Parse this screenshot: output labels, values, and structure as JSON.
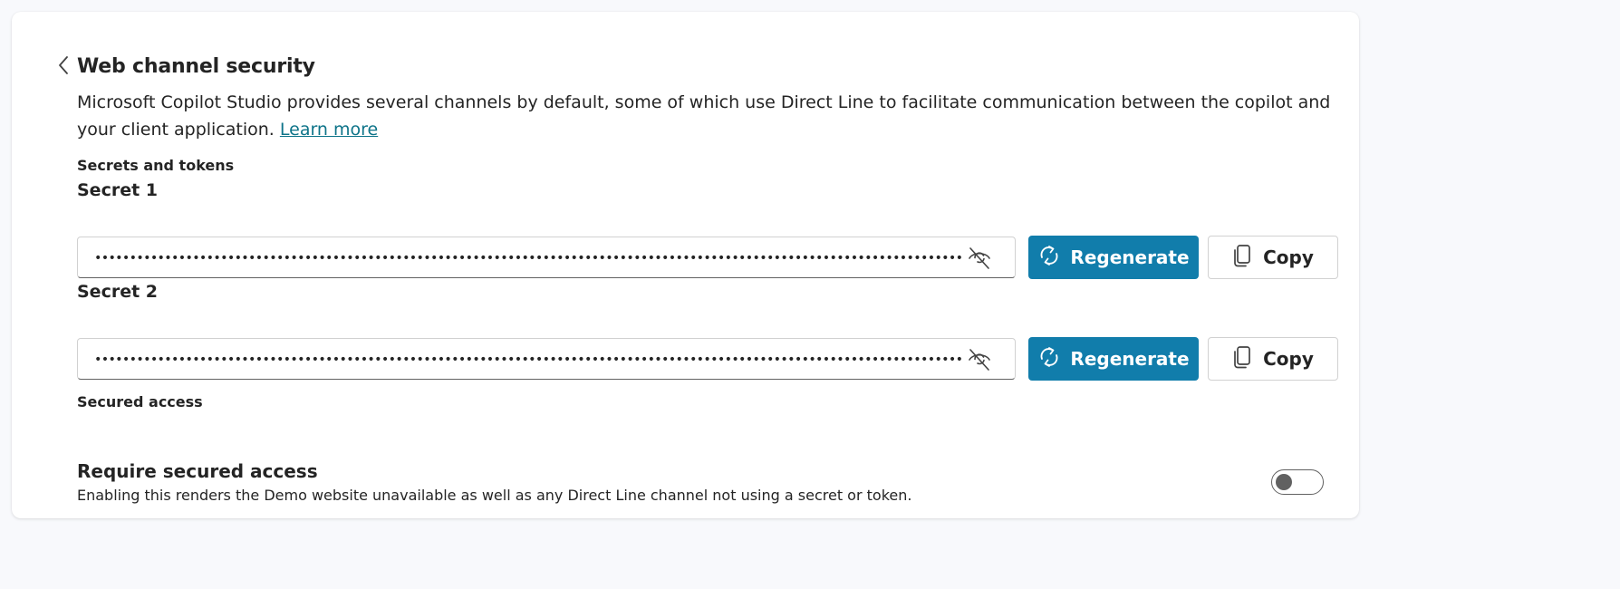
{
  "header": {
    "back_icon": "chevron-left-icon",
    "title": "Web channel security"
  },
  "intro": {
    "text": "Microsoft Copilot Studio provides several channels by default, some of which use Direct Line to facilitate communication between the copilot and your client application. ",
    "link_label": "Learn more"
  },
  "secrets_section": {
    "heading": "Secrets and tokens",
    "secrets": [
      {
        "label": "Secret 1",
        "masked_value": "••••••••••••••••••••••••••••••••••••••••••••••••••••••••••••••••••••••••••••••••••••••••••••••••••••••••••••••••••••••••••••••••••••••••••••",
        "visibility_icon": "eye-off-icon",
        "regenerate_label": "Regenerate",
        "regenerate_icon": "arrow-sync-icon",
        "copy_label": "Copy",
        "copy_icon": "copy-icon"
      },
      {
        "label": "Secret 2",
        "masked_value": "••••••••••••••••••••••••••••••••••••••••••••••••••••••••••••••••••••••••••••••••••••••••••••••••••••••••••••••••••••••••••••••••••••••••••••",
        "visibility_icon": "eye-off-icon",
        "regenerate_label": "Regenerate",
        "regenerate_icon": "arrow-sync-icon",
        "copy_label": "Copy",
        "copy_icon": "copy-icon"
      }
    ]
  },
  "secured_access_section": {
    "heading": "Secured access",
    "setting_title": "Require secured access",
    "setting_description": "Enabling this renders the Demo website unavailable as well as any Direct Line channel not using a secret or token.",
    "toggle_on": false
  },
  "colors": {
    "primary_button": "#117dab",
    "link": "#0e7489",
    "page_background": "#f8f9fc",
    "card_background": "#ffffff"
  }
}
